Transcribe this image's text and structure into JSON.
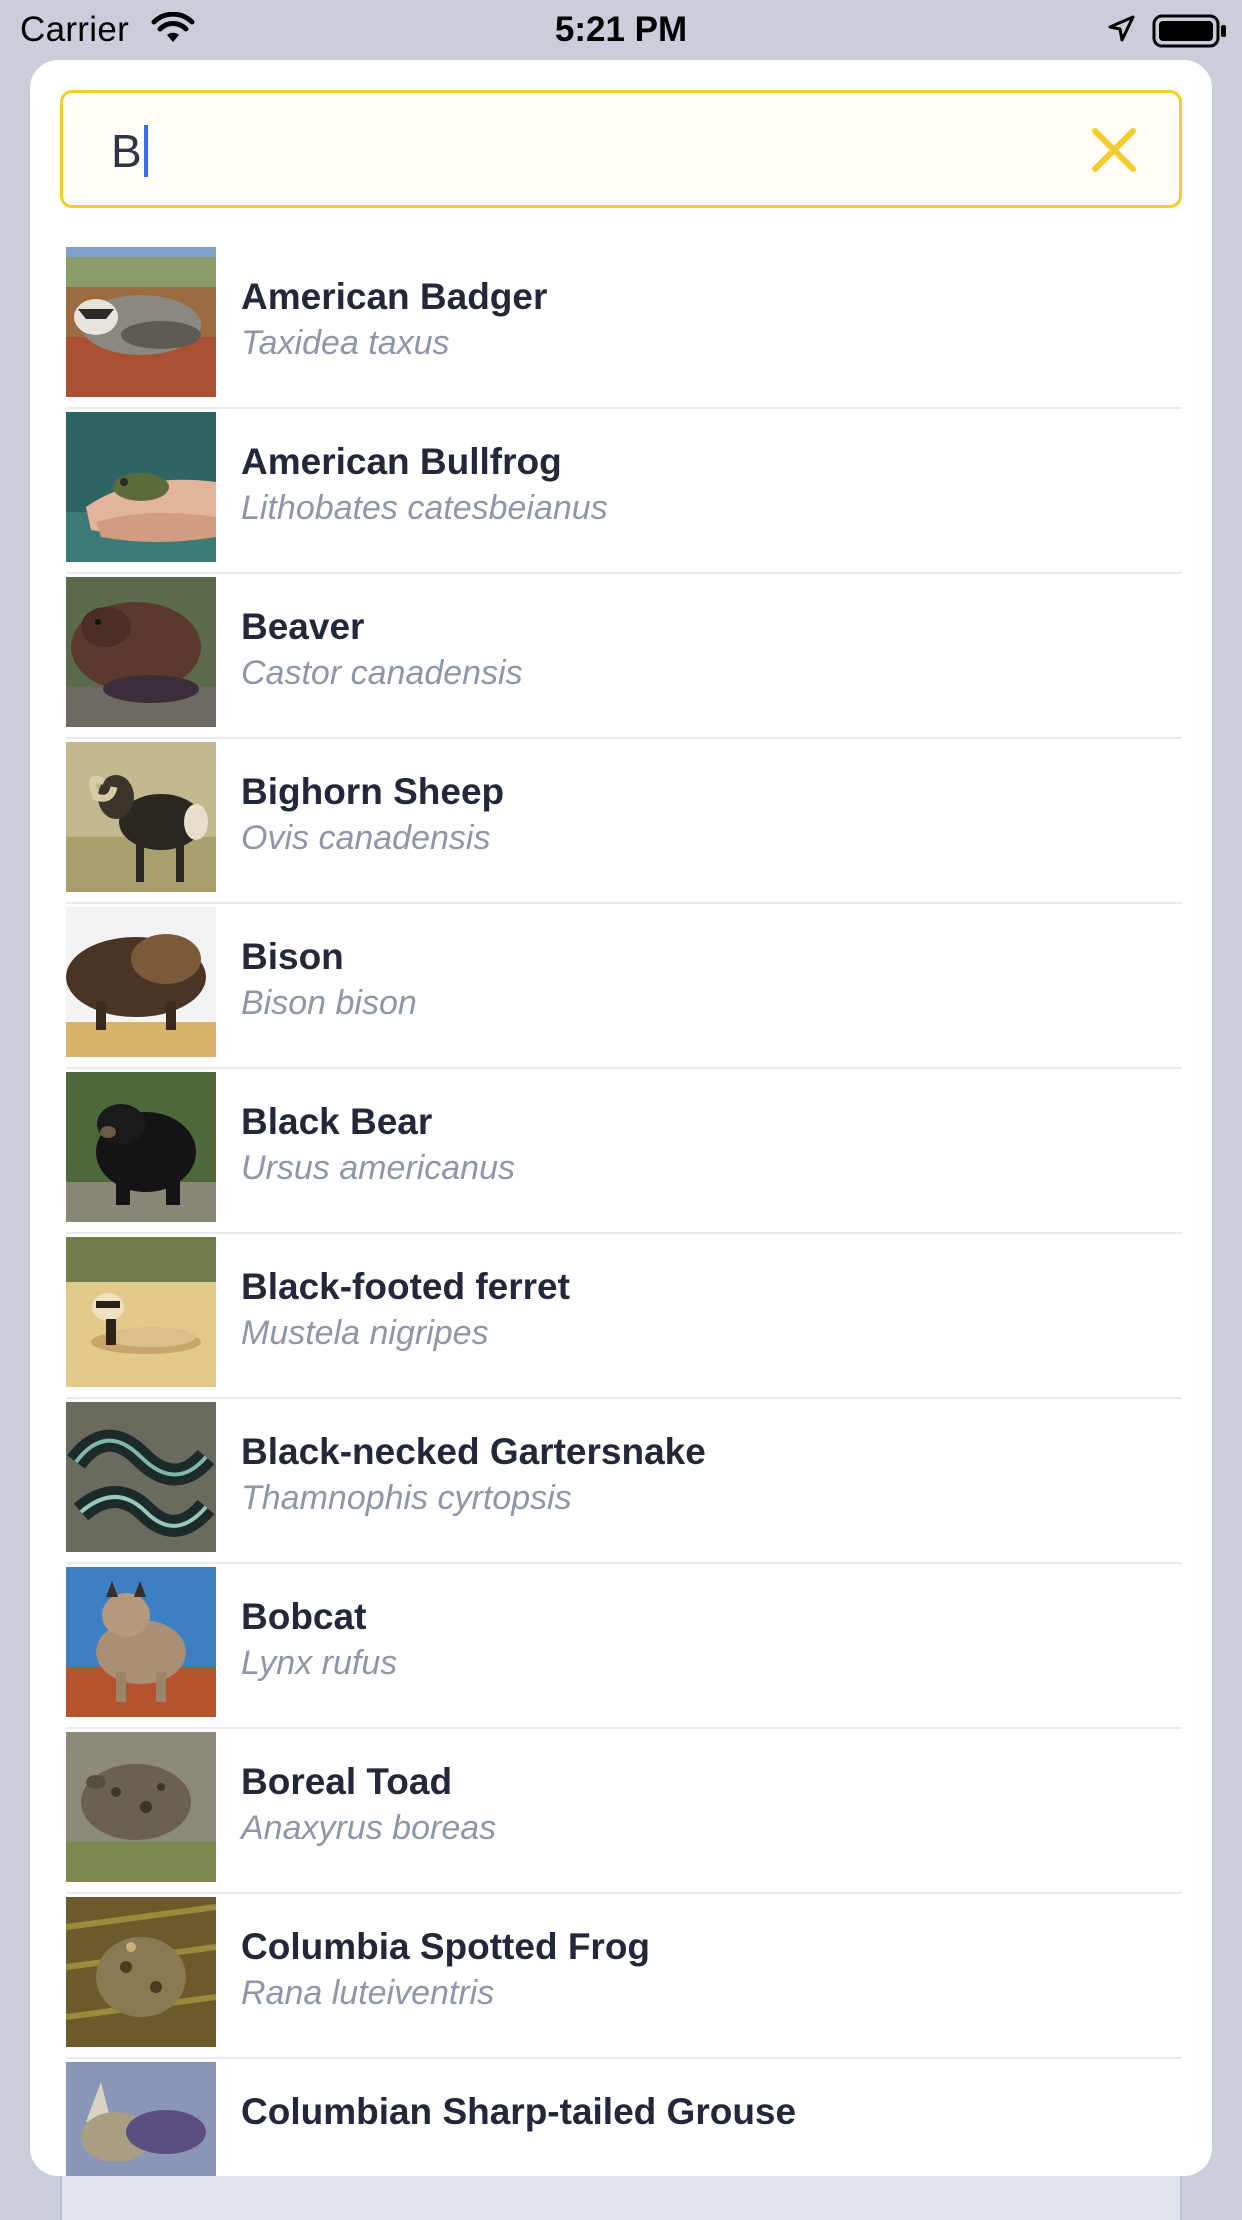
{
  "status": {
    "carrier": "Carrier",
    "time": "5:21 PM"
  },
  "search": {
    "value": "B",
    "accent": "#f5cc2e",
    "caret_color": "#3b6ef2"
  },
  "results": [
    {
      "common": "American Badger",
      "scientific": "Taxidea taxus"
    },
    {
      "common": "American Bullfrog",
      "scientific": "Lithobates catesbeianus"
    },
    {
      "common": "Beaver",
      "scientific": "Castor canadensis"
    },
    {
      "common": "Bighorn Sheep",
      "scientific": "Ovis canadensis"
    },
    {
      "common": "Bison",
      "scientific": "Bison bison"
    },
    {
      "common": "Black Bear",
      "scientific": "Ursus americanus"
    },
    {
      "common": "Black-footed ferret",
      "scientific": "Mustela nigripes"
    },
    {
      "common": "Black-necked Gartersnake",
      "scientific": "Thamnophis cyrtopsis"
    },
    {
      "common": "Bobcat",
      "scientific": "Lynx rufus"
    },
    {
      "common": "Boreal Toad",
      "scientific": "Anaxyrus boreas"
    },
    {
      "common": "Columbia Spotted Frog",
      "scientific": "Rana luteiventris"
    },
    {
      "common": "Columbian Sharp-tailed Grouse",
      "scientific": ""
    }
  ]
}
